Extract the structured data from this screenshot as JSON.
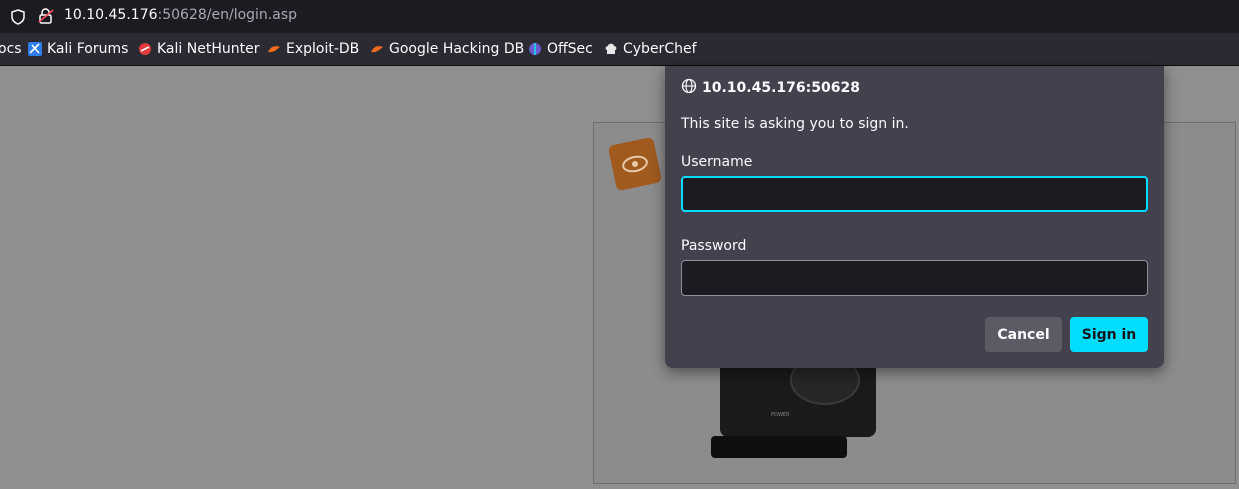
{
  "urlbar": {
    "url_host": "10.10.45.176",
    "url_rest": ":50628/en/login.asp"
  },
  "bookmarks": [
    {
      "label": "ocs",
      "icon": "bookmark-icon"
    },
    {
      "label": "Kali Forums",
      "icon": "kali-forums-icon"
    },
    {
      "label": "Kali NetHunter",
      "icon": "kali-nethunter-icon"
    },
    {
      "label": "Exploit-DB",
      "icon": "exploit-db-icon"
    },
    {
      "label": "Google Hacking DB",
      "icon": "ghdb-icon"
    },
    {
      "label": "OffSec",
      "icon": "offsec-icon"
    },
    {
      "label": "CyberChef",
      "icon": "cyberchef-icon"
    }
  ],
  "dialog": {
    "host": "10.10.45.176:50628",
    "message": "This site is asking you to sign in.",
    "username_label": "Username",
    "username_value": "",
    "password_label": "Password",
    "password_value": "",
    "cancel_label": "Cancel",
    "signin_label": "Sign in"
  },
  "page": {
    "camera_label": "POWER"
  },
  "colors": {
    "accent": "#00ddff",
    "dialog_bg": "#42414d",
    "toolbar_bg": "#2b2a33",
    "urlbar_bg": "#1c1b22"
  }
}
